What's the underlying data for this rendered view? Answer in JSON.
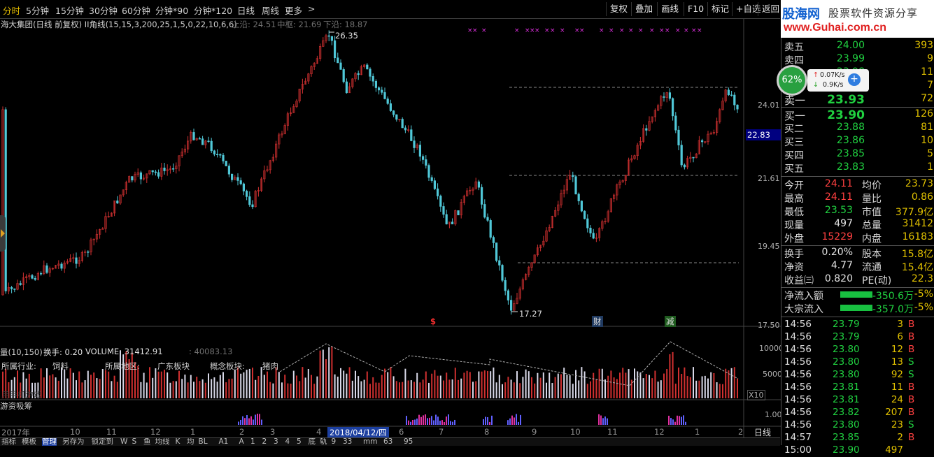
{
  "toolbar": {
    "period_tabs": [
      "分时",
      "5分钟",
      "15分钟",
      "30分钟",
      "60分钟",
      "分钟*90",
      "分钟*120",
      "日线",
      "周线",
      "更多"
    ],
    "more_arrow": ">",
    "right_buttons": [
      "复权",
      "叠加",
      "画线",
      "F10",
      "标记",
      "+自选",
      "返回"
    ]
  },
  "chart": {
    "title": "海大集团(日线 前复权) II角线(15,15,3,200,25,1,5,0,22,10,6,6)",
    "upper_label": "上沿: 24.51",
    "mid_label": "中枢: 21.69",
    "lower_label": "下沿: 18.87",
    "high_mark": "26.35",
    "low_mark": "17.27",
    "price_ticks": [
      "24.01",
      "21.61",
      "19.45",
      "17.50"
    ],
    "current_price": "22.83",
    "event_marks": [
      "$",
      "财",
      "减"
    ],
    "volume_title": "量(10,150)",
    "turnover": "换手: 0.20",
    "volume_value": "VOLUME: 31412.91",
    "volume_ma": ": 40083.13",
    "volume_ticks": [
      "10000",
      "5000"
    ],
    "volume_unit": "X10",
    "industry_label": "所属行业:",
    "industry": "饲料",
    "region_label": "所属地区:",
    "region": "广东板块",
    "concept_label": "概念板块:",
    "concept": "猪肉",
    "watermark": "用手机游戏",
    "fund_title": "游资吸筹",
    "fund_tick": "1.00",
    "date_axis": [
      "2017年",
      "10",
      "11",
      "12",
      "1",
      "2",
      "3",
      "4",
      "2018/04/12/四",
      "6",
      "7",
      "8",
      "9",
      "10",
      "11",
      "12",
      "1",
      "2"
    ],
    "axis_period": "日线"
  },
  "bottom_tabs": [
    "指标",
    "模板",
    "管理",
    "另存为",
    "锁定到",
    "W",
    "S",
    "鱼",
    "均线",
    "K",
    "均",
    "BL",
    "A1",
    "A",
    "1",
    "2",
    "3",
    "4",
    "5",
    "底",
    "轨",
    "9",
    "33",
    "mm",
    "63",
    "95"
  ],
  "network": {
    "percent": "62%",
    "up": "0.07K/s",
    "down": "0.9K/s"
  },
  "logo": {
    "line1": "股海网",
    "line2": "股票软件资源分享",
    "url": "www.Guhai.com.cn"
  },
  "quote": {
    "asks": [
      {
        "name": "卖五",
        "price": "24.00",
        "vol": "393"
      },
      {
        "name": "卖四",
        "price": "23.99",
        "vol": "9"
      },
      {
        "name": "卖三",
        "price": "23.98",
        "vol": "11"
      },
      {
        "name": "卖二",
        "price": "23.95",
        "vol": "7"
      },
      {
        "name": "卖一",
        "price": "23.93",
        "vol": "72"
      }
    ],
    "bids": [
      {
        "name": "买一",
        "price": "23.90",
        "vol": "126"
      },
      {
        "name": "买二",
        "price": "23.88",
        "vol": "81"
      },
      {
        "name": "买三",
        "price": "23.86",
        "vol": "10"
      },
      {
        "name": "买四",
        "price": "23.85",
        "vol": "5"
      },
      {
        "name": "买五",
        "price": "23.83",
        "vol": "1"
      }
    ],
    "stats": [
      {
        "l": "今开",
        "lv": "24.11",
        "r": "均价",
        "rv": "23.73"
      },
      {
        "l": "最高",
        "lv": "24.11",
        "r": "量比",
        "rv": "0.86"
      },
      {
        "l": "最低",
        "lv": "23.53",
        "r": "市值",
        "rv": "377.9亿"
      },
      {
        "l": "现量",
        "lv": "497",
        "r": "总量",
        "rv": "31412"
      },
      {
        "l": "外盘",
        "lv": "15229",
        "r": "内盘",
        "rv": "16183"
      }
    ],
    "stats2": [
      {
        "l": "换手",
        "lv": "0.20%",
        "r": "股本",
        "rv": "15.8亿"
      },
      {
        "l": "净资",
        "lv": "4.77",
        "r": "流通",
        "rv": "15.4亿"
      },
      {
        "l": "收益㈢",
        "lv": "0.820",
        "r": "PE(动)",
        "rv": "22.3"
      }
    ],
    "flows": [
      {
        "l": "净流入额",
        "v": "-350.6万",
        "pct": "-5%"
      },
      {
        "l": "大宗流入",
        "v": "-357.0万",
        "pct": "-5%"
      }
    ],
    "ticks": [
      {
        "t": "14:56",
        "p": "23.79",
        "v": "3",
        "d": "B"
      },
      {
        "t": "14:56",
        "p": "23.79",
        "v": "6",
        "d": "B"
      },
      {
        "t": "14:56",
        "p": "23.80",
        "v": "12",
        "d": "B"
      },
      {
        "t": "14:56",
        "p": "23.80",
        "v": "13",
        "d": "S"
      },
      {
        "t": "14:56",
        "p": "23.80",
        "v": "92",
        "d": "S"
      },
      {
        "t": "14:56",
        "p": "23.81",
        "v": "11",
        "d": "B"
      },
      {
        "t": "14:56",
        "p": "23.81",
        "v": "24",
        "d": "B"
      },
      {
        "t": "14:56",
        "p": "23.82",
        "v": "207",
        "d": "B"
      },
      {
        "t": "14:56",
        "p": "23.80",
        "v": "23",
        "d": "S"
      },
      {
        "t": "14:57",
        "p": "23.85",
        "v": "2",
        "d": "B"
      },
      {
        "t": "15:00",
        "p": "23.90",
        "v": "497",
        "d": ""
      }
    ]
  }
}
